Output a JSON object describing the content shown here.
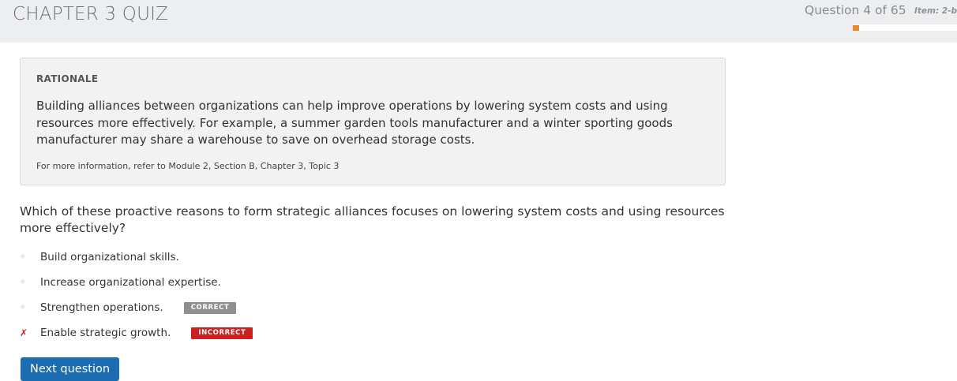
{
  "header": {
    "title": "CHAPTER 3 QUIZ",
    "progress_text": "Question 4 of 65",
    "item_code": "Item: 2-b",
    "progress_fraction": 0.062,
    "progress_color": "#e8892d"
  },
  "rationale": {
    "heading": "RATIONALE",
    "body": "Building alliances between organizations can help improve operations by lowering system costs and using resources more effectively. For example, a summer garden tools manufacturer and a winter sporting goods manufacturer may share a warehouse to save on overhead storage costs.",
    "reference": "For more information, refer to Module 2, Section B, Chapter 3, Topic 3"
  },
  "question": {
    "text": "Which of these proactive reasons to form strategic alliances focuses on lowering system costs and using resources more effectively?"
  },
  "answers": [
    {
      "label": "Build organizational skills.",
      "marker": "diamond"
    },
    {
      "label": "Increase organizational expertise.",
      "marker": "diamond"
    },
    {
      "label": "Strengthen operations.",
      "marker": "diamond",
      "badge": "CORRECT"
    },
    {
      "label": "Enable strategic growth.",
      "marker": "x",
      "badge": "INCORRECT"
    }
  ],
  "bullet_symbols": {
    "diamond": "✧",
    "x": "✗"
  },
  "footer": {
    "next_label": "Next question",
    "next_color": "#1b6cb0"
  }
}
